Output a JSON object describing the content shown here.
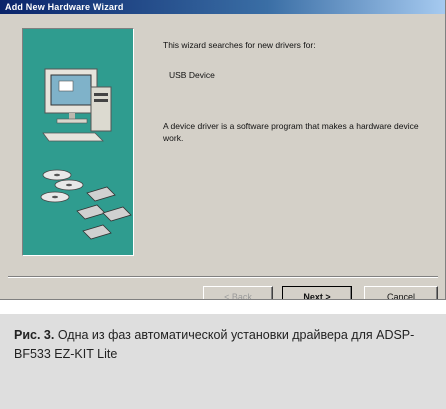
{
  "window": {
    "title": "Add New Hardware Wizard"
  },
  "content": {
    "search_intro": "This wizard searches for new drivers for:",
    "device_name": "USB Device",
    "description": "A device driver is a software program that makes a hardware device work."
  },
  "buttons": {
    "back": "< Back",
    "next": "Next >",
    "cancel": "Cancel"
  },
  "caption": {
    "label": "Рис. 3.",
    "text": " Одна из фаз автоматической установки драйвера для ADSP-BF533 EZ-KIT Lite"
  },
  "colors": {
    "panel": "#2f9c8f",
    "dialog": "#d4d0c8",
    "title_bar": "#0a246a",
    "caption_bg": "#dedede"
  },
  "icons": [
    "computer-icon",
    "cd-disc-icon",
    "floppy-disk-icon"
  ]
}
